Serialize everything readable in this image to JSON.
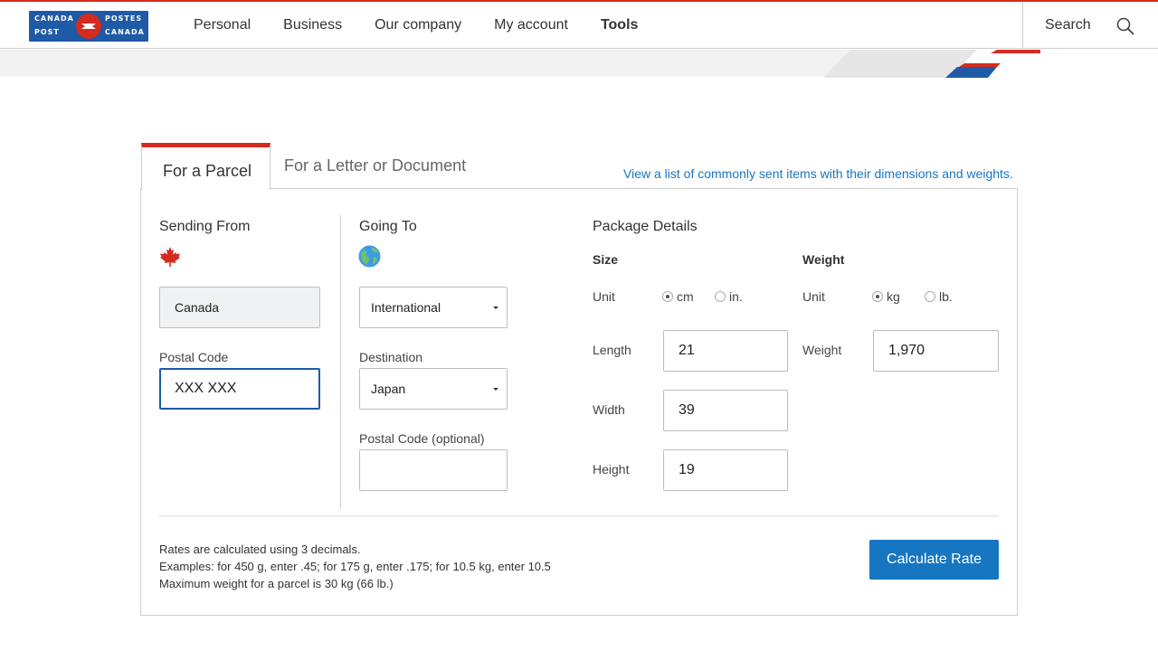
{
  "header": {
    "logo_text": [
      "CANADA",
      "POSTES",
      "POST",
      "CANADA"
    ],
    "nav": [
      "Personal",
      "Business",
      "Our company",
      "My account",
      "Tools"
    ],
    "search_label": "Search"
  },
  "tabs": {
    "active": "For a Parcel",
    "inactive": "For a Letter or Document"
  },
  "list_link": "View a list of commonly sent items with their dimensions and weights.",
  "sending_from": {
    "heading": "Sending From",
    "country": "Canada",
    "postal_label": "Postal Code",
    "postal_value": "XXX XXX"
  },
  "going_to": {
    "heading": "Going To",
    "type_value": "International",
    "destination_label": "Destination",
    "destination_value": "Japan",
    "postal_label": "Postal Code (optional)",
    "postal_value": ""
  },
  "package": {
    "heading": "Package Details",
    "size_label": "Size",
    "weight_label": "Weight",
    "unit_label": "Unit",
    "size_units": [
      "cm",
      "in."
    ],
    "weight_units": [
      "kg",
      "lb."
    ],
    "size_unit_selected": "cm",
    "weight_unit_selected": "kg",
    "length_label": "Length",
    "length_value": "21",
    "width_label": "Width",
    "width_value": "39",
    "height_label": "Height",
    "height_value": "19",
    "weight_field_label": "Weight",
    "weight_value": "1,970"
  },
  "notes": [
    "Rates are calculated using 3 decimals.",
    "Examples: for 450 g, enter .45; for 175 g, enter .175; for 10.5 kg, enter 10.5",
    "Maximum weight for a parcel is 30 kg (66 lb.)"
  ],
  "calculate_button": "Calculate Rate",
  "colors": {
    "brand_red": "#d52b1e",
    "brand_blue": "#1f5aa6",
    "button_blue": "#1676c2"
  }
}
